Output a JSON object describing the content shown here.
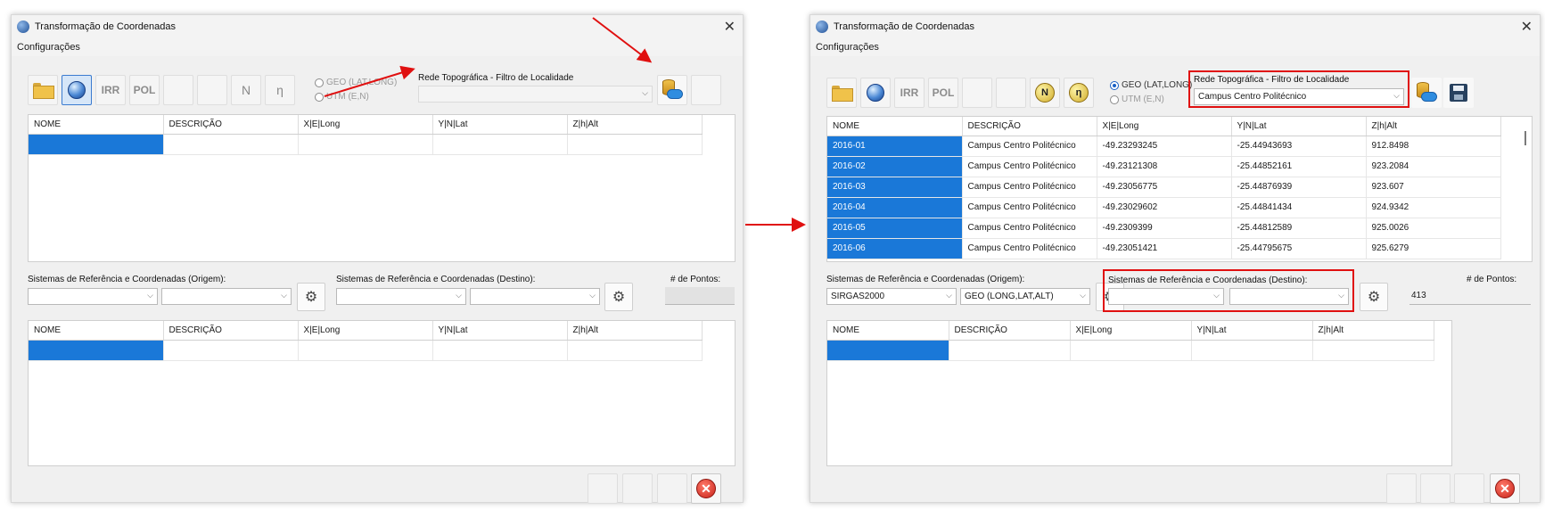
{
  "columns": [
    "NOME",
    "DESCRIÇÃO",
    "X|E|Long",
    "Y|N|Lat",
    "Z|h|Alt"
  ],
  "before": {
    "title": "Transformação de Coordenadas",
    "menu": "Configurações",
    "toolbar": {
      "irr": "IRR",
      "pol": "POL",
      "n": "N",
      "eta": "η"
    },
    "radio_geo": "GEO (LAT,LONG)",
    "radio_utm": "UTM (E,N)",
    "filter_label": "Rede Topográfica - Filtro de Localidade",
    "filter_value": "",
    "origin_label": "Sistemas de Referência e Coordenadas (Origem):",
    "origin_system": "",
    "origin_type": "",
    "dest_label": "Sistemas de Referência e Coordenadas (Destino):",
    "dest_system": "",
    "dest_type": "",
    "points_label": "# de Pontos:",
    "points_value": ""
  },
  "after": {
    "title": "Transformação de Coordenadas",
    "menu": "Configurações",
    "toolbar": {
      "irr": "IRR",
      "pol": "POL",
      "n": "N",
      "eta": "η"
    },
    "radio_geo": "GEO (LAT,LONG)",
    "radio_utm": "UTM (E,N)",
    "filter_label": "Rede Topográfica - Filtro de Localidade",
    "filter_value": "Campus Centro Politécnico",
    "origin_label": "Sistemas de Referência e Coordenadas (Origem):",
    "origin_system": "SIRGAS2000",
    "origin_type": "GEO (LONG,LAT,ALT)",
    "dest_label": "Sistemas de Referência e Coordenadas (Destino):",
    "dest_system": "",
    "dest_type": "",
    "points_label": "# de Pontos:",
    "points_value": "413",
    "rows": [
      [
        "2016-01",
        "Campus Centro Politécnico",
        "-49.23293245",
        "-25.44943693",
        "912.8498"
      ],
      [
        "2016-02",
        "Campus Centro Politécnico",
        "-49.23121308",
        "-25.44852161",
        "923.2084"
      ],
      [
        "2016-03",
        "Campus Centro Politécnico",
        "-49.23056775",
        "-25.44876939",
        "923.607"
      ],
      [
        "2016-04",
        "Campus Centro Politécnico",
        "-49.23029602",
        "-25.44841434",
        "924.9342"
      ],
      [
        "2016-05",
        "Campus Centro Politécnico",
        "-49.2309399",
        "-25.44812589",
        "925.0026"
      ],
      [
        "2016-06",
        "Campus Centro Politécnico",
        "-49.23051421",
        "-25.44795675",
        "925.6279"
      ]
    ]
  },
  "colors": {
    "annotation": "#e01010",
    "selection": "#1a78d8"
  }
}
